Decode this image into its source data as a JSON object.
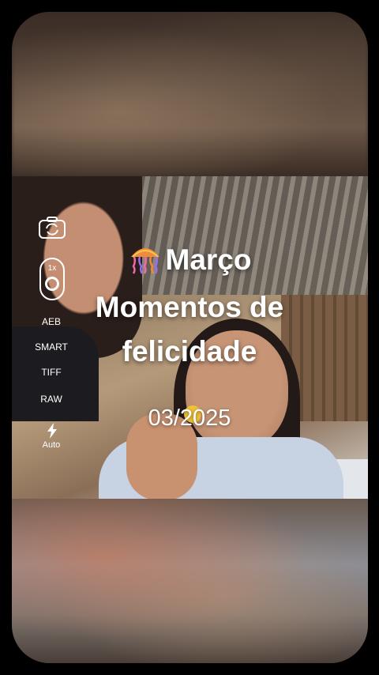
{
  "overlay": {
    "line1": "Março",
    "line1_emoji": "jellyfish-emoji",
    "line2": "Momentos de",
    "line3": "felicidade",
    "date": "03/2025"
  },
  "camera_controls": {
    "camera_icon": "camera-switch-icon",
    "zoom": "1x",
    "shutter_icon": "shutter-icon",
    "items": [
      "AEB",
      "SMART",
      "TIFF",
      "RAW"
    ],
    "flash_icon": "flash-icon",
    "flash_mode": "Auto"
  },
  "colors": {
    "background": "#000000",
    "text": "#ffffff"
  }
}
